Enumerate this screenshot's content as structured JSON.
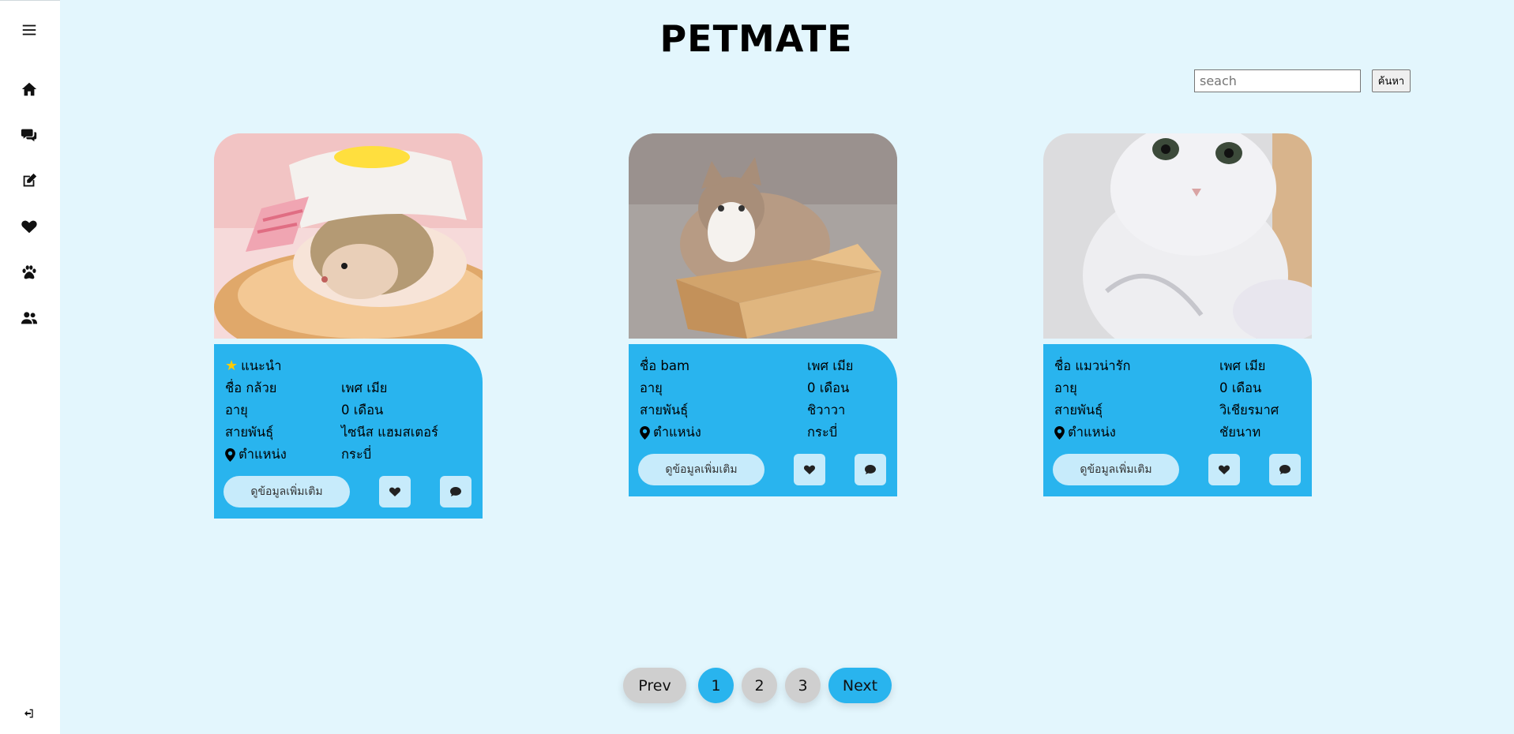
{
  "app": {
    "title": "PETMATE"
  },
  "search": {
    "placeholder": "seach",
    "button_label": "ค้นหา"
  },
  "sidebar": {
    "items": [
      {
        "icon": "menu-icon"
      },
      {
        "icon": "home-icon"
      },
      {
        "icon": "chat-icon"
      },
      {
        "icon": "edit-icon"
      },
      {
        "icon": "heart-icon"
      },
      {
        "icon": "paw-icon"
      },
      {
        "icon": "users-icon"
      },
      {
        "icon": "logout-icon"
      }
    ]
  },
  "labels": {
    "recommended": "แนะนำ",
    "age": "อายุ",
    "breed": "สายพันธุ์",
    "location": "ตำแหน่ง",
    "more_info": "ดูข้อมูลเพิ่มเติม"
  },
  "cards": [
    {
      "recommended": true,
      "name": "ชื่อ กล้วย",
      "gender": "เพศ เมีย",
      "age": "0 เดือน",
      "breed": "ไซนีส แฮมสเตอร์",
      "location": "กระบี่",
      "photo": "hedgehog-photo"
    },
    {
      "recommended": false,
      "name": "ชื่อ bam",
      "gender": "เพศ เมีย",
      "age": "0 เดือน",
      "breed": "ชิวาวา",
      "location": "กระบี่",
      "photo": "cat-in-box-photo"
    },
    {
      "recommended": false,
      "name": "ชื่อ แมวน่ารัก",
      "gender": "เพศ เมีย",
      "age": "0 เดือน",
      "breed": "วิเชียรมาศ",
      "location": "ชัยนาท",
      "photo": "white-cat-photo"
    }
  ],
  "pagination": {
    "prev": "Prev",
    "pages": [
      "1",
      "2",
      "3"
    ],
    "current": "1",
    "next": "Next"
  },
  "colors": {
    "background": "#e3f6fd",
    "accent": "#29b4ee",
    "button_light": "#c7ebfb",
    "page_inactive": "#cfcfcf"
  }
}
